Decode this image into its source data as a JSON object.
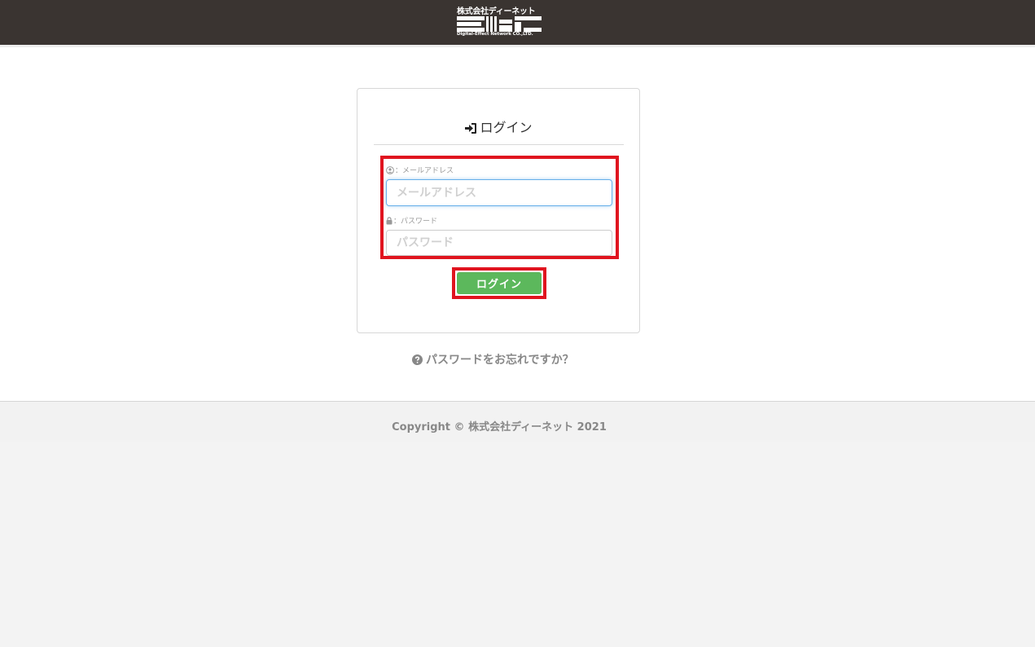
{
  "header": {
    "logo_company": "株式会社ディーネット",
    "logo_subtitle": "Digital-Effect Network CO.,LTD."
  },
  "login_card": {
    "title": "ログイン",
    "email": {
      "label": "：メールアドレス",
      "placeholder": "メールアドレス",
      "value": ""
    },
    "password": {
      "label": "：パスワード",
      "placeholder": "パスワード",
      "value": ""
    },
    "submit_label": "ログイン"
  },
  "forgot_password": "パスワードをお忘れですか？",
  "footer": {
    "copyright": "Copyright © 株式会社ディーネット 2021"
  },
  "icons": {
    "login": "sign-in-icon",
    "user": "user-circle-icon",
    "lock": "lock-icon",
    "help": "question-circle-icon"
  },
  "colors": {
    "header_bg": "#3a3431",
    "button_green": "#5cb85c",
    "highlight_red": "#e0141f",
    "focus_blue": "#66afe9"
  }
}
